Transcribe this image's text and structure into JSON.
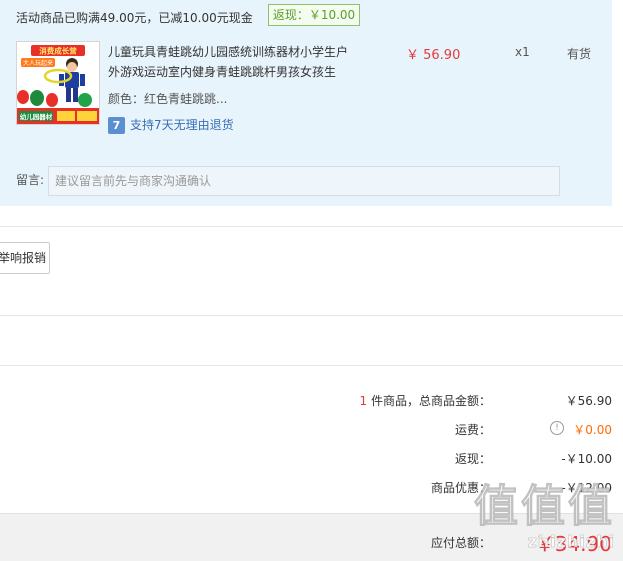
{
  "order": {
    "promo_text": "活动商品已购满49.00元，已减10.00元现金",
    "rebate_badge": "返现：￥10.00",
    "item": {
      "thumb_banner_top": "消费成长营",
      "thumb_banner_sub": "大人玩起来",
      "thumb_banner_bottom": "幼儿园器材",
      "title": "儿童玩具青蛙跳幼儿园感统训练器材小学生户外游戏运动室内健身青蛙跳跳杆男孩女孩生",
      "variant": "颜色：红色青蛙跳跳...",
      "return_icon": "7",
      "return_label": "支持7天无理由退货",
      "price": "￥ 56.90",
      "quantity": "x1",
      "stock": "有货"
    },
    "remark": {
      "label": "留言:",
      "placeholder": "建议留言前先与商家沟通确认",
      "value": ""
    }
  },
  "report_button": "举响报销",
  "summary": {
    "count": "1",
    "count_text": " 件商品，总商品金额：",
    "goods_total": "￥56.90",
    "shipping_label": "运费：",
    "shipping_value": "￥0.00",
    "rebate_label": "返现：",
    "rebate_value": "-￥10.00",
    "discount_label": "商品优惠：",
    "discount_value": "-￥12.00",
    "payable_label": "应付总额：",
    "payable_value": "￥34.90"
  },
  "watermark": {
    "main": "值值值",
    "sub": "zhizhizhi"
  },
  "colors": {
    "price_red": "#e4393c",
    "shipping_orange": "#ff6a00",
    "order_bg": "#e8f4fb",
    "rebate_green": "#5aa02c",
    "link_blue": "#3a6eb5"
  },
  "icons": {
    "return": "seven-day-return-icon",
    "info": "info-circle-icon"
  }
}
